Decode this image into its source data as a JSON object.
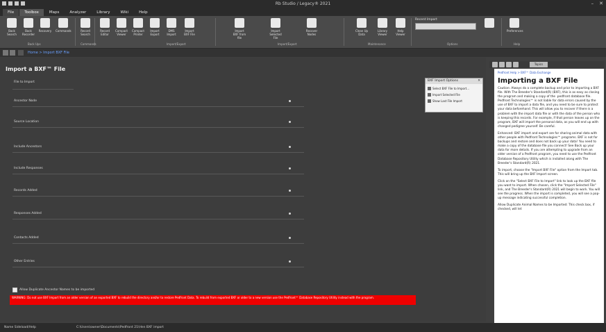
{
  "window": {
    "title": "Rb Studio / Legacy® 2021"
  },
  "menu": {
    "tabs": [
      "File",
      "Toolbox",
      "Maps",
      "Analyzer",
      "Library",
      "Wiki",
      "Help"
    ],
    "active": 1
  },
  "ribbon": {
    "buttons": [
      "Back Search",
      "Back Recorder",
      "Recovery",
      "Commands",
      "Record Search",
      "Record Editor",
      "Compact Viewer",
      "Compact Printer",
      "Import Export",
      "DMS Import",
      "Import BXF File",
      "Import BXF from file",
      "Import Selected File",
      "Recover Nodes",
      "Clean Up Data",
      "Library Viewer",
      "Help Viewer",
      "Preferences"
    ],
    "groups": [
      "Back Ups",
      "Commands",
      "Import/Export",
      "Import/Export",
      "Maintenance",
      "Options",
      "Help"
    ],
    "select_label": "Recent Import"
  },
  "address": {
    "crumb": "Home > Import BXF File"
  },
  "form": {
    "title": "Import a BXF™ File",
    "fields": [
      "File to Import",
      "Ancestor Node",
      "Source Location",
      "Include Ancestors",
      "Include Responses",
      "Records Added",
      "Responses Added",
      "Contacts Added",
      "Other Entries"
    ],
    "checkbox_label": "Allow Duplicate Ancestor Names to be imported",
    "warning": "WARNING: Do not use BXF Import from an older version of an exported BXF to rebuild the directory and/or to restore Pedfront Data. To rebuild from exported BXF or older to a new version use the Pedfront™ Database Repository Utility instead with the program."
  },
  "options": {
    "title": "BXF Import Options",
    "items": [
      "Select BXF File to Import...",
      "Import Selected File",
      "Show Last File Import"
    ]
  },
  "status": {
    "left": "Name  Sideload/Help",
    "path": "C:\\Users\\owner\\Documents\\Pedfront 21\\Hen BXF import"
  },
  "help": {
    "tab": "Topics",
    "breadcrumb": "Pedfront Help > BXF™ Data Exchange",
    "title": "Importing a BXF File",
    "paragraphs": [
      "Caution: Always do a complete backup and prior to importing a BXF file. With The Breeder's Standard(R) (BXF), this is as easy as closing the program and making a copy of the .pedfront database file. Pedfront Technologies™ is not liable for data errors caused by the use of BXF to import a data file, and you need to be sure to protect your data beforehand. This will allow you to recover if there is a problem with the import data file or with the data of the person who is keeping this records. For example, if that person leaves up on the program, BXF will import the personal data, as you will end up with changed pedigree yourself. Be careful.",
      "Enhanced: BXF import and export are for sharing animal data with other people with Pedfront Technologies™ programs. BXF is not for backups and restore and does not back up your data! You need to make a copy of the database file you connect! See Back up your data for more details. If you are attempting to upgrade from an older version of a Pedfront program, you need to use the Pedfront Database Repository Utility which is installed along with The Breeder's Standard(R) 2021.",
      "To import, choose the \"Import BXF File\" option from the Import tab. This will bring up the BXF Import screen.",
      "Click on the \"Select BXF File to Import\" link to look up the BXF file you want to import. When chosen, click the \"Import Selected File\" link, and The Breeder's Standard(R) 2021 will begin to work. You will see the progress. When the import is completed, you will see a pop-up message indicating successful completion.",
      "Allow Duplicate Animal Names to be Imported: This check box, if checked, will let"
    ]
  }
}
